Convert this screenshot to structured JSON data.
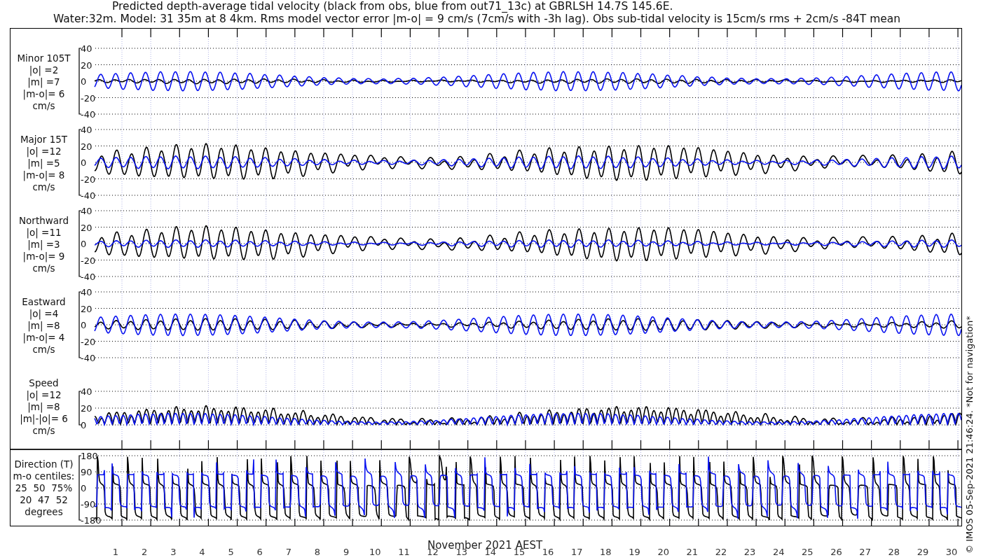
{
  "title": "Predicted depth-average tidal velocity (black from obs, blue from out71_13c) at GBRLSH 14.7S 145.6E.",
  "subtitle": "Water:32m. Model: 31 35m at 8 4km. Rms model vector error |m-o| = 9 cm/s (7cm/s with -3h lag). Obs sub-tidal velocity is 15cm/s rms + 2cm/s -84T mean",
  "panels": [
    {
      "kind": "minor",
      "label_lines": [
        "Minor 105T",
        "|o| =2",
        "|m| =7",
        "|m-o|= 6",
        "cm/s"
      ],
      "yticks": [
        "40",
        "20",
        "0",
        "-20",
        "-40"
      ]
    },
    {
      "kind": "major",
      "label_lines": [
        "Major 15T",
        "|o| =12",
        "|m| =5",
        "|m-o|= 8",
        "cm/s"
      ],
      "yticks": [
        "40",
        "20",
        "0",
        "-20",
        "-40"
      ]
    },
    {
      "kind": "north",
      "label_lines": [
        "Northward",
        "|o| =11",
        "|m| =3",
        "|m-o|= 9",
        "cm/s"
      ],
      "yticks": [
        "40",
        "20",
        "0",
        "-20",
        "-40"
      ]
    },
    {
      "kind": "east",
      "label_lines": [
        "Eastward",
        "|o| =4",
        "|m| =8",
        "|m-o|= 4",
        "cm/s"
      ],
      "yticks": [
        "40",
        "20",
        "0",
        "-20",
        "-40"
      ]
    },
    {
      "kind": "speed",
      "label_lines": [
        "Speed",
        "|o| =12",
        "|m| =8",
        "|m|-|o|= 6",
        "cm/s"
      ],
      "yticks": [
        "40",
        "20",
        "0"
      ]
    },
    {
      "kind": "direction",
      "label_lines": [
        "Direction (T)",
        "m-o centiles:",
        "25  50  75%",
        "20  47  52",
        "degrees"
      ],
      "yticks": [
        "180",
        "90",
        "0",
        "-90",
        "-180"
      ]
    }
  ],
  "x_labels": [
    "1",
    "2",
    "3",
    "4",
    "5",
    "6",
    "7",
    "8",
    "9",
    "10",
    "11",
    "12",
    "13",
    "14",
    "15",
    "16",
    "17",
    "18",
    "19",
    "20",
    "21",
    "22",
    "23",
    "24",
    "25",
    "26",
    "27",
    "28",
    "29",
    "30"
  ],
  "xlabel": "November 2021 AEST",
  "credit": "© IMOS 05-Sep-2021 21:46:24. *Not for navigation*"
}
